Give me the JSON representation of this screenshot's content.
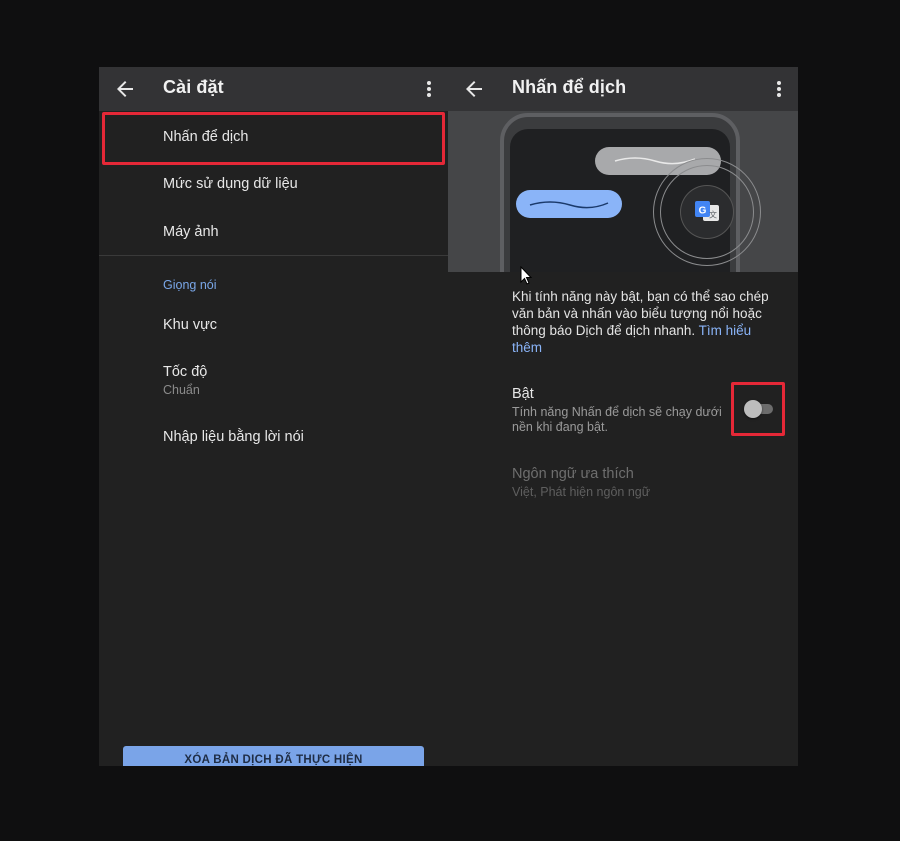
{
  "left_panel": {
    "title": "Cài đặt",
    "items": [
      {
        "label": "Nhấn để dịch"
      },
      {
        "label": "Mức sử dụng dữ liệu"
      },
      {
        "label": "Máy ảnh"
      }
    ],
    "voice_section": {
      "title": "Giọng nói",
      "items": [
        {
          "label": "Khu vực",
          "sub": ""
        },
        {
          "label": "Tốc độ",
          "sub": "Chuẩn"
        },
        {
          "label": "Nhập liệu bằng lời nói",
          "sub": ""
        }
      ]
    },
    "clear_button": "XÓA BẢN DỊCH ĐÃ THỰC HIỆN"
  },
  "right_panel": {
    "title": "Nhấn để dịch",
    "description": "Khi tính năng này bật, bạn có thể sao chép văn bản và nhấn vào biểu tượng nổi hoặc thông báo Dịch để dịch nhanh.",
    "learn_more": "Tìm hiểu thêm",
    "enable": {
      "label": "Bật",
      "sub": "Tính năng Nhấn để dịch sẽ chạy dưới nền khi đang bật.",
      "state": "off"
    },
    "preferred_languages": {
      "label": "Ngôn ngữ ưa thích",
      "sub": "Việt, Phát hiện ngôn ngữ"
    }
  },
  "colors": {
    "highlight": "#e52837",
    "accent": "#8ab4f8",
    "background": "#212121"
  },
  "icons": [
    "back-arrow-icon",
    "more-vert-icon",
    "google-translate-icon",
    "mouse-cursor-icon"
  ]
}
